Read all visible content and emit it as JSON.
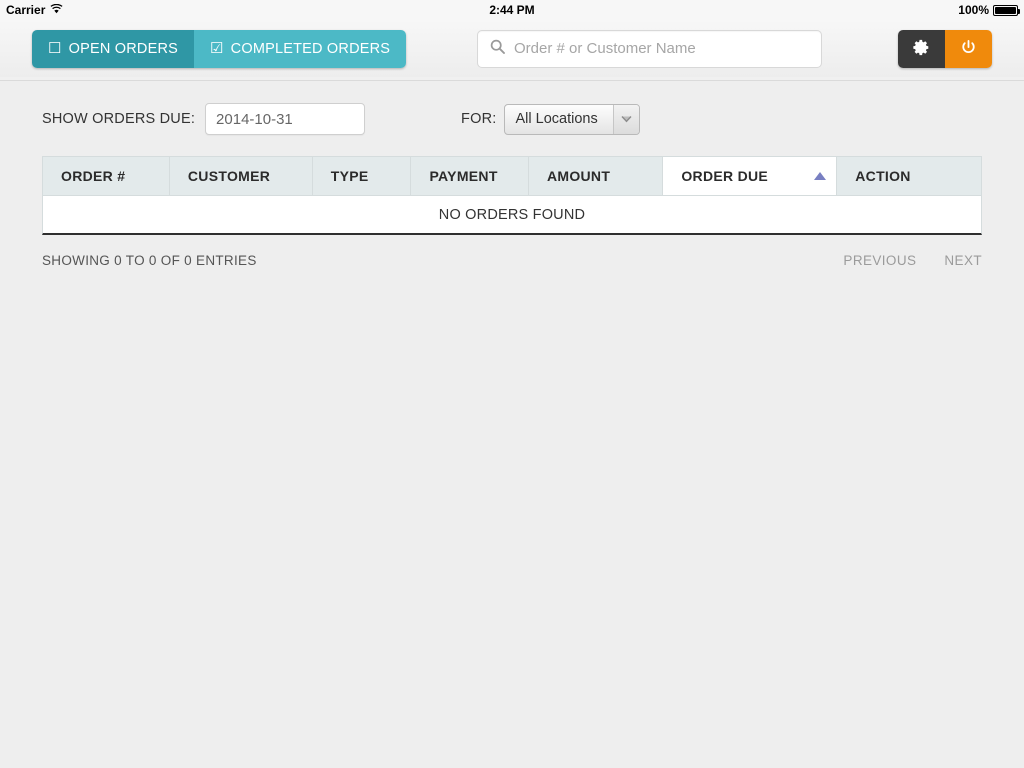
{
  "status_bar": {
    "carrier": "Carrier",
    "wifi_icon": "wifi-icon",
    "time": "2:44 PM",
    "battery_percent": "100%",
    "battery_icon": "battery-full-icon"
  },
  "toolbar": {
    "tabs": [
      {
        "label": "OPEN ORDERS",
        "icon": "checkbox-empty-icon",
        "active": false,
        "color": "#2f97a5"
      },
      {
        "label": "COMPLETED ORDERS",
        "icon": "checkbox-checked-icon",
        "active": true,
        "color": "#4cb9c6"
      }
    ],
    "search": {
      "icon": "search-icon",
      "placeholder": "Order # or Customer Name",
      "value": ""
    },
    "actions": [
      {
        "name": "settings-button",
        "icon": "gear-icon",
        "color": "#3a3a3a"
      },
      {
        "name": "power-button",
        "icon": "power-icon",
        "color": "#f08a0c"
      }
    ]
  },
  "filters": {
    "date_label": "SHOW ORDERS DUE:",
    "date_value": "2014-10-31",
    "for_label": "FOR:",
    "location_value": "All Locations",
    "location_options": [
      "All Locations"
    ],
    "dropdown_icon": "chevron-down-icon"
  },
  "table": {
    "columns": [
      {
        "label": "ORDER #",
        "sorted": false
      },
      {
        "label": "CUSTOMER",
        "sorted": false
      },
      {
        "label": "TYPE",
        "sorted": false
      },
      {
        "label": "PAYMENT",
        "sorted": false
      },
      {
        "label": "AMOUNT",
        "sorted": false
      },
      {
        "label": "ORDER DUE",
        "sorted": true,
        "sort_direction": "asc",
        "sort_icon": "triangle-up-icon",
        "sort_color": "#787fc2"
      },
      {
        "label": "ACTION",
        "sorted": false
      }
    ],
    "rows": [],
    "empty_message": "NO ORDERS FOUND"
  },
  "footer": {
    "showing_entries": "SHOWING 0 TO 0 OF 0 ENTRIES",
    "previous_label": "PREVIOUS",
    "next_label": "NEXT"
  }
}
